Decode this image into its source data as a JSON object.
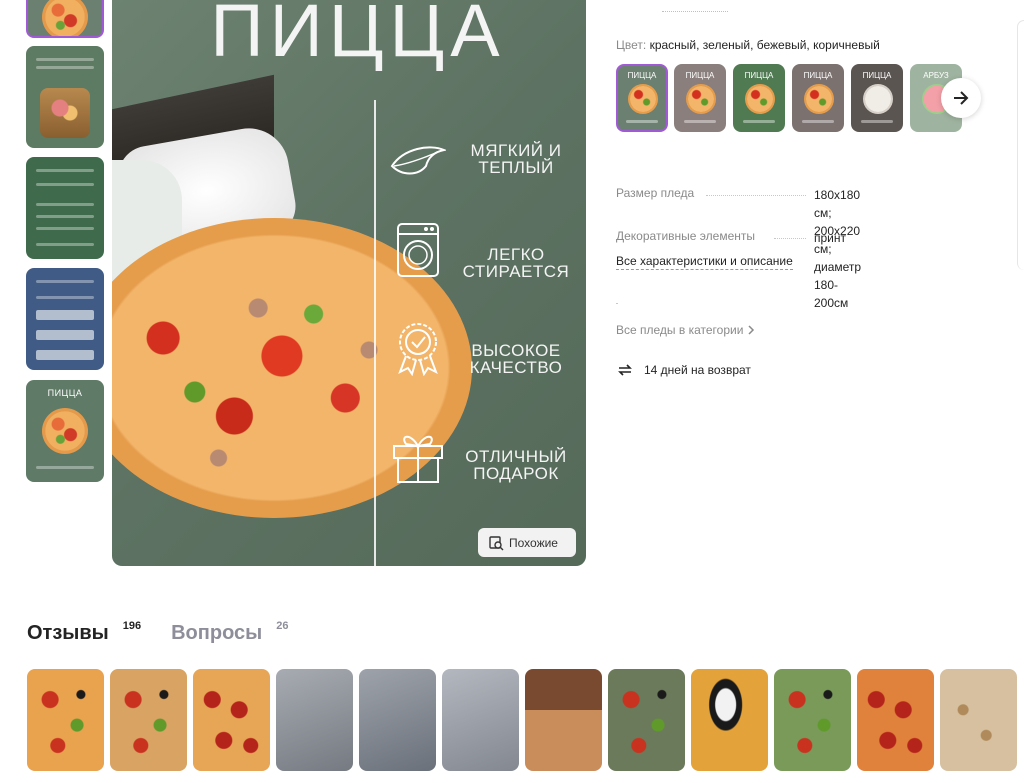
{
  "main_image": {
    "title": "ПИЦЦА",
    "features": [
      {
        "icon": "feather-icon",
        "label": "МЯГКИЙ И ТЕПЛЫЙ"
      },
      {
        "icon": "washing-machine-icon",
        "label": "ЛЕГКО СТИРАЕТСЯ"
      },
      {
        "icon": "quality-badge-icon",
        "label": "ВЫСОКОЕ КАЧЕСТВО"
      },
      {
        "icon": "gift-icon",
        "label": "ОТЛИЧНЫЙ ПОДАРОК"
      }
    ],
    "similar_button": "Похожие"
  },
  "thumbnails": [
    {
      "caption": "",
      "bg": "#6b8070"
    },
    {
      "caption": "",
      "bg": "#5d7a62"
    },
    {
      "caption": "",
      "bg": "#3f6a4c"
    },
    {
      "caption": "",
      "bg": "#3f5b86"
    },
    {
      "caption": "ПИЦЦА",
      "bg": "#5f7a66"
    }
  ],
  "product": {
    "color_label": "Цвет:",
    "color_value": "красный, зеленый, бежевый, коричневый",
    "swatches": [
      {
        "caption": "ПИЦЦА",
        "bg": "#6b8070"
      },
      {
        "caption": "ПИЦЦА",
        "bg": "#8a7f7c"
      },
      {
        "caption": "ПИЦЦА",
        "bg": "#4f7a52"
      },
      {
        "caption": "ПИЦЦА",
        "bg": "#7b7270"
      },
      {
        "caption": "ПИЦЦА",
        "bg": "#5b5552"
      },
      {
        "caption": "АРБУЗ",
        "bg": "#9fb4a0"
      }
    ],
    "specs": [
      {
        "key": "Размер пледа",
        "value_line1": "180х180 см; 200х220 см;",
        "value_line2": "диаметр 180-200см"
      },
      {
        "key": "Декоративные элементы",
        "value_line1": "принт",
        "value_line2": ""
      }
    ],
    "all_specs_link": "Все характеристики и описание",
    "all_category_link": "Все пледы в категории",
    "return_text": "14 дней на возврат"
  },
  "reviews": {
    "tabs": [
      {
        "label": "Отзывы",
        "count": "196"
      },
      {
        "label": "Вопросы",
        "count": "26"
      }
    ],
    "photos": [
      {
        "bg": "#e9a24e",
        "kind": "pizza"
      },
      {
        "bg": "#d8a363",
        "kind": "pizza"
      },
      {
        "bg": "#e7a556",
        "kind": "pepperoni"
      },
      {
        "bg": "#8a8f98",
        "kind": "fabric"
      },
      {
        "bg": "#7d848f",
        "kind": "fabric"
      },
      {
        "bg": "#9aa0aa",
        "kind": "fabric"
      },
      {
        "bg": "#a66d43",
        "kind": "room"
      },
      {
        "bg": "#6b7a5a",
        "kind": "pizza"
      },
      {
        "bg": "#e3a33a",
        "kind": "cat"
      },
      {
        "bg": "#7a9a5a",
        "kind": "pizza"
      },
      {
        "bg": "#e0823c",
        "kind": "pepperoni"
      },
      {
        "bg": "#d6c0a0",
        "kind": "tortilla"
      }
    ]
  }
}
